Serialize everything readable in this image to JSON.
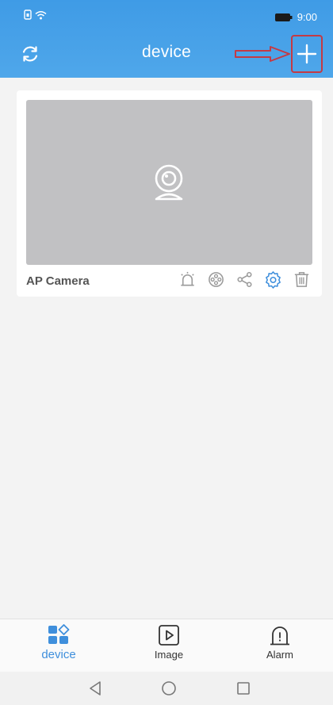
{
  "status": {
    "time": "9:00"
  },
  "header": {
    "title": "device"
  },
  "devices": [
    {
      "name": "AP Camera"
    }
  ],
  "nav": [
    {
      "label": "device",
      "icon": "device-grid-icon",
      "active": true
    },
    {
      "label": "Image",
      "icon": "play-box-icon",
      "active": false
    },
    {
      "label": "Alarm",
      "icon": "alarm-bell-icon",
      "active": false
    }
  ],
  "colors": {
    "header_bg": "#4aa3e8",
    "accent": "#3f8fdc",
    "highlight_box": "#c43a44"
  }
}
